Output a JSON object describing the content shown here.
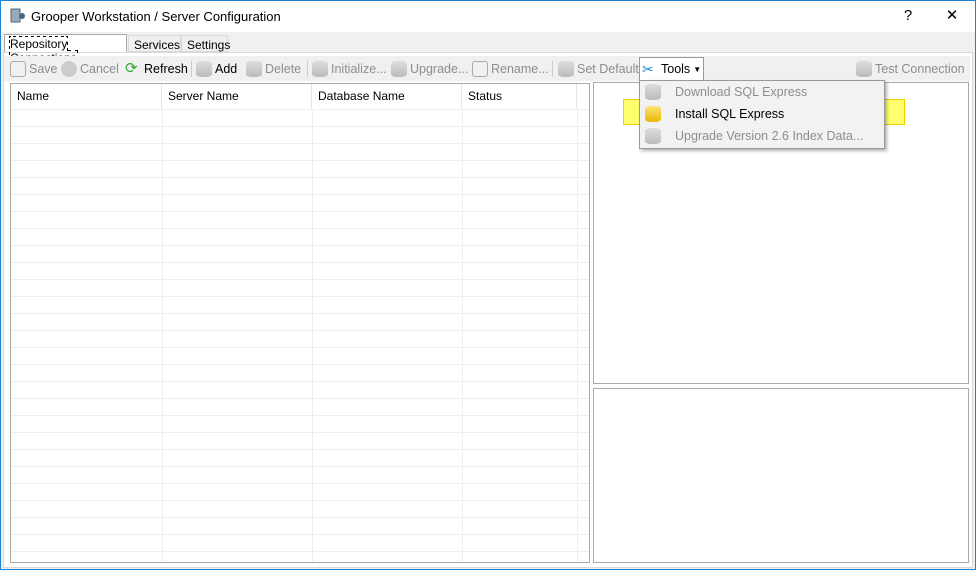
{
  "window": {
    "title": "Grooper Workstation / Server Configuration",
    "help": "?",
    "close": "✕"
  },
  "tabs": [
    {
      "label": "Repository Connections"
    },
    {
      "label": "Services"
    },
    {
      "label": "Settings"
    }
  ],
  "toolbar": {
    "save": "Save",
    "cancel": "Cancel",
    "refresh": "Refresh",
    "add": "Add",
    "delete": "Delete",
    "initialize": "Initialize...",
    "upgrade": "Upgrade...",
    "rename": "Rename...",
    "set_default": "Set Default",
    "tools": "Tools",
    "test_connection": "Test Connection"
  },
  "grid": {
    "columns": [
      "Name",
      "Server Name",
      "Database Name",
      "Status"
    ],
    "rows": []
  },
  "tools_menu": {
    "items": [
      {
        "label": "Download SQL Express",
        "enabled": false
      },
      {
        "label": "Install SQL Express",
        "enabled": true,
        "highlighted": true
      },
      {
        "label": "Upgrade Version 2.6 Index Data...",
        "enabled": false
      }
    ]
  },
  "colors": {
    "highlight": "#ffff3c",
    "accent": "#1883d7"
  }
}
